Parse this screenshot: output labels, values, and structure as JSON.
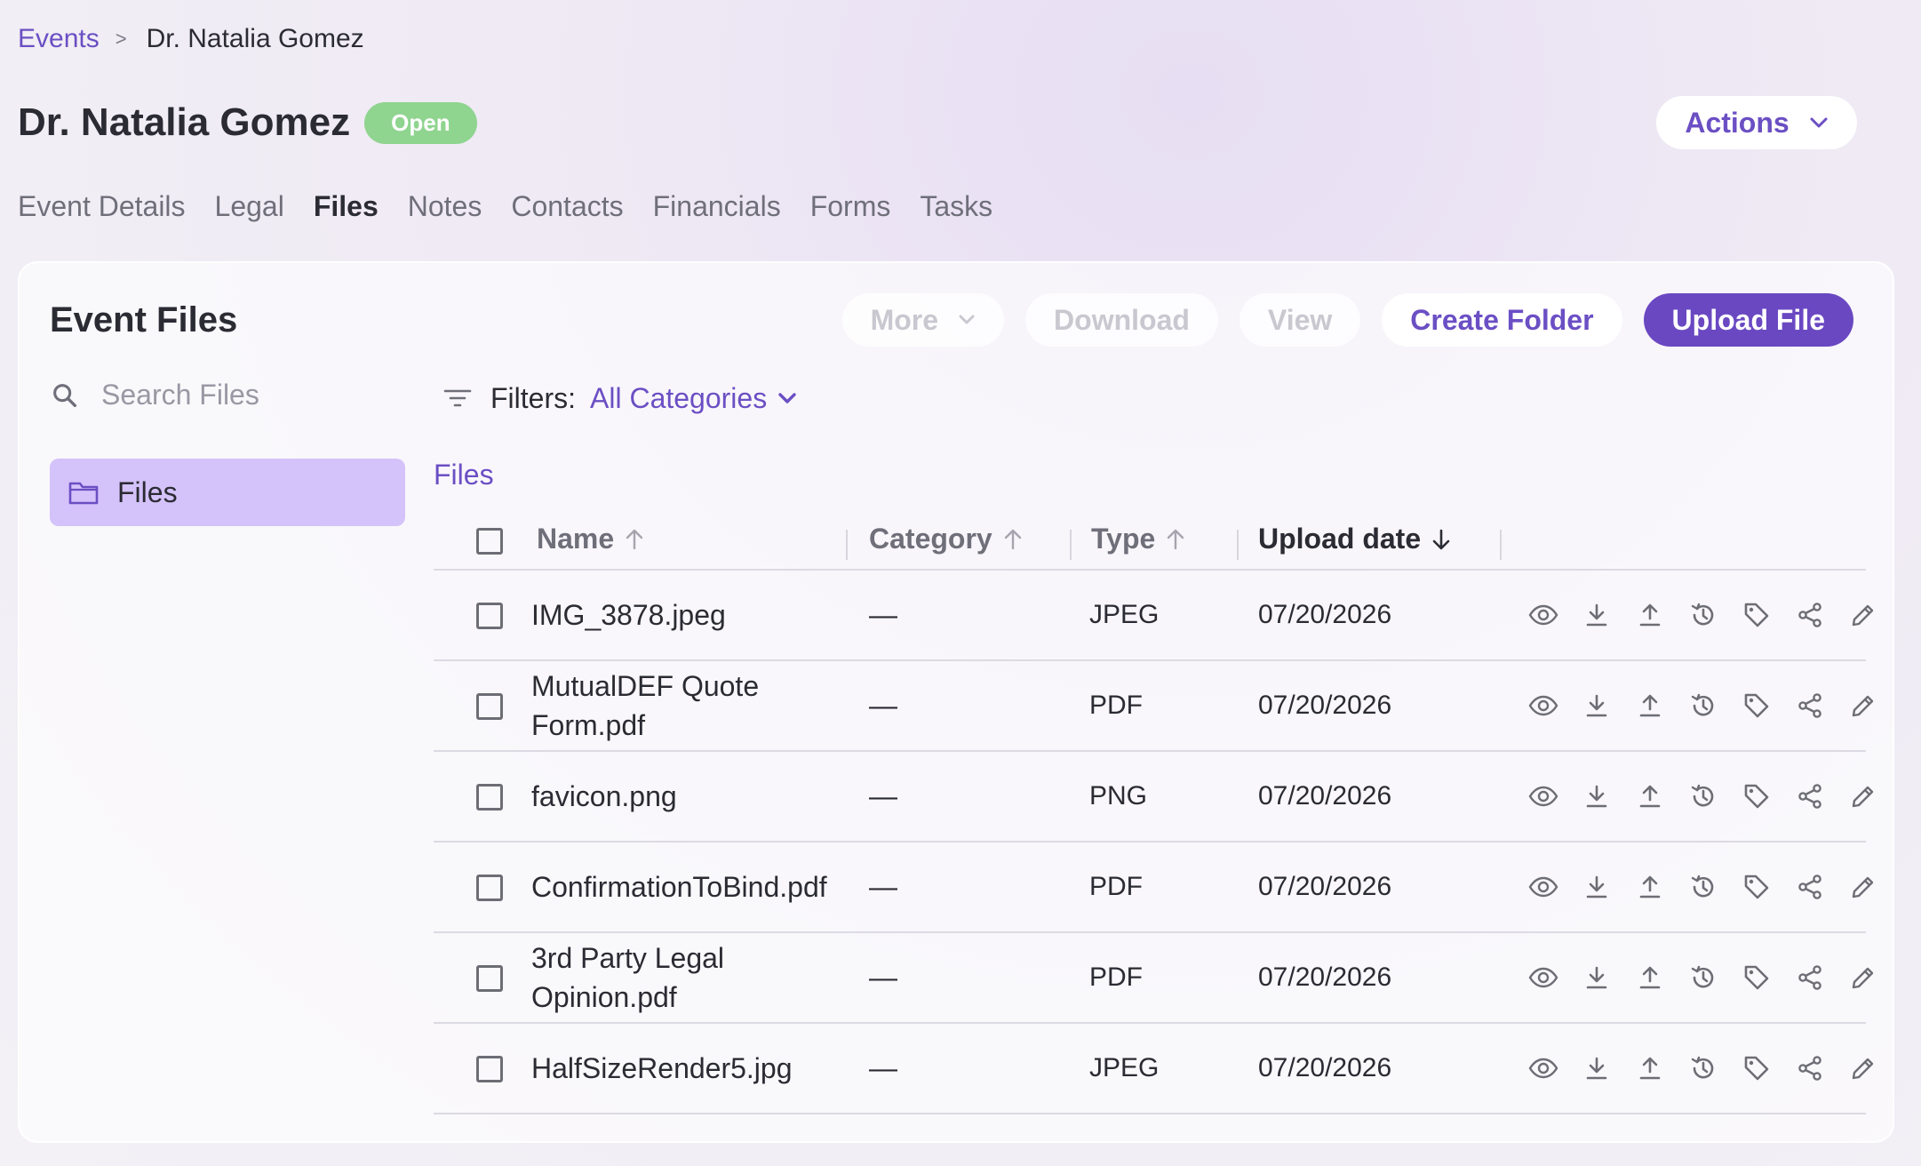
{
  "breadcrumb": {
    "parent": "Events",
    "separator": ">",
    "current": "Dr. Natalia Gomez"
  },
  "page": {
    "title": "Dr. Natalia Gomez",
    "status": "Open",
    "actions_label": "Actions"
  },
  "tabs": [
    {
      "label": "Event Details",
      "active": false
    },
    {
      "label": "Legal",
      "active": false
    },
    {
      "label": "Files",
      "active": true
    },
    {
      "label": "Notes",
      "active": false
    },
    {
      "label": "Contacts",
      "active": false
    },
    {
      "label": "Financials",
      "active": false
    },
    {
      "label": "Forms",
      "active": false
    },
    {
      "label": "Tasks",
      "active": false
    }
  ],
  "panel": {
    "title": "Event Files",
    "buttons": {
      "more": "More",
      "download": "Download",
      "view": "View",
      "create_folder": "Create Folder",
      "upload": "Upload File"
    },
    "search_placeholder": "Search Files",
    "folder": "Files",
    "filters_label": "Filters:",
    "filters_value": "All Categories",
    "section_label": "Files"
  },
  "table": {
    "columns": {
      "name": "Name",
      "category": "Category",
      "type": "Type",
      "upload_date": "Upload date"
    },
    "rows": [
      {
        "name": "IMG_3878.jpeg",
        "category": "—",
        "type": "JPEG",
        "date": "07/20/2026"
      },
      {
        "name": "MutualDEF Quote Form.pdf",
        "category": "—",
        "type": "PDF",
        "date": "07/20/2026"
      },
      {
        "name": "favicon.png",
        "category": "—",
        "type": "PNG",
        "date": "07/20/2026"
      },
      {
        "name": "ConfirmationToBind.pdf",
        "category": "—",
        "type": "PDF",
        "date": "07/20/2026"
      },
      {
        "name": "3rd Party Legal Opinion.pdf",
        "category": "—",
        "type": "PDF",
        "date": "07/20/2026"
      },
      {
        "name": "HalfSizeRender5.jpg",
        "category": "—",
        "type": "JPEG",
        "date": "07/20/2026"
      }
    ],
    "row_actions": [
      "eye-icon",
      "download-icon",
      "upload-icon",
      "history-icon",
      "tag-icon",
      "share-icon",
      "edit-icon"
    ]
  },
  "colors": {
    "accent": "#6a48c2",
    "link": "#6b4fc4",
    "badge": "#8fd48f",
    "folder_highlight": "#d4c2fa"
  }
}
